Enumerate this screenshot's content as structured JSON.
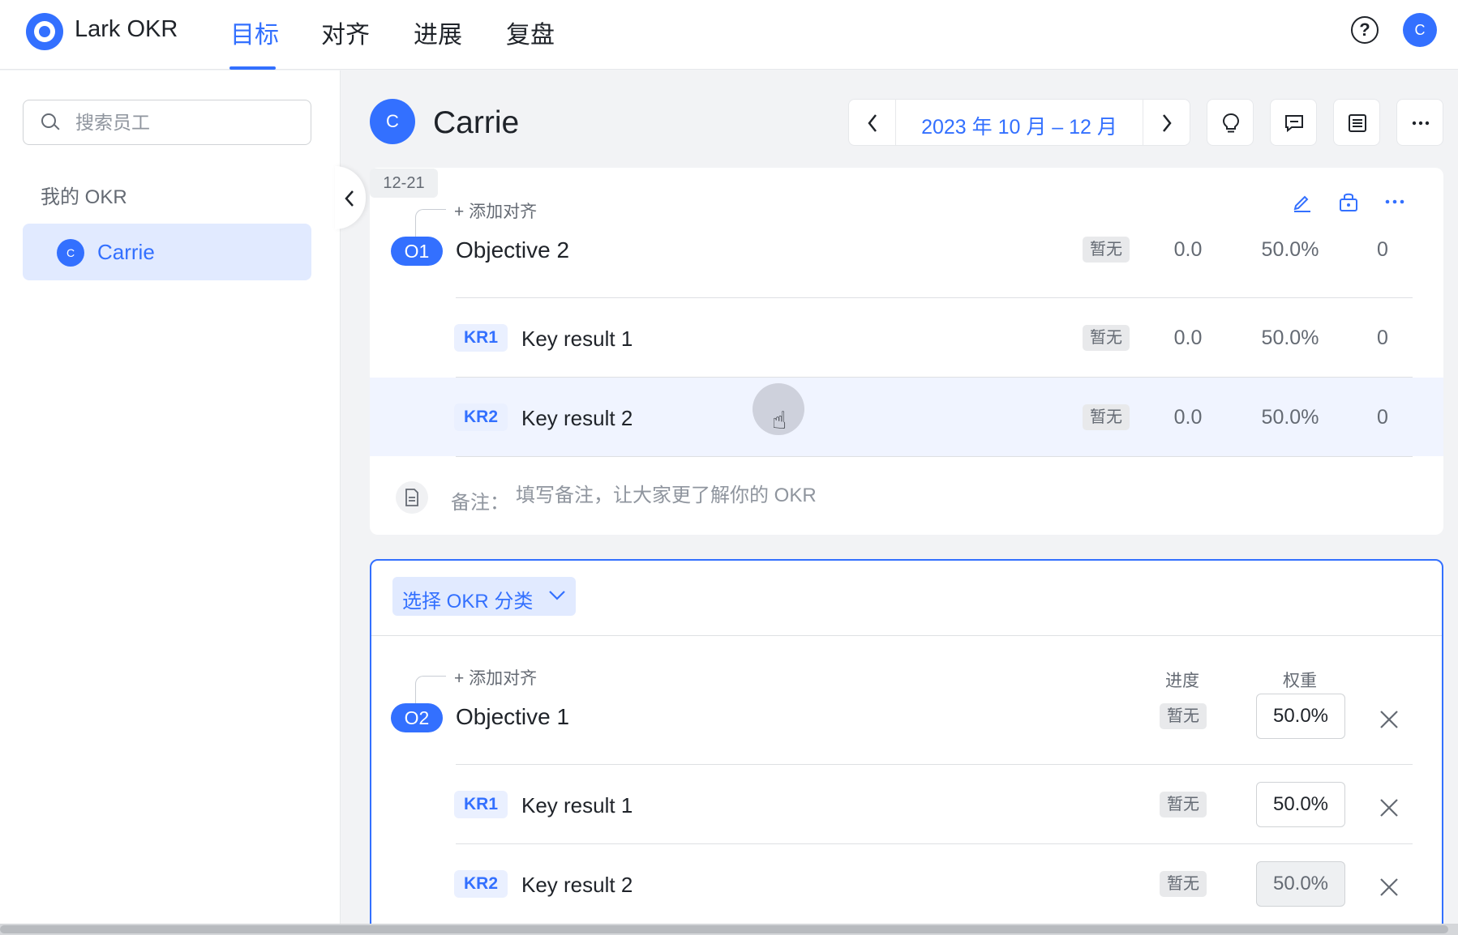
{
  "app": {
    "name": "Lark OKR"
  },
  "nav": {
    "tabs": [
      "目标",
      "对齐",
      "进展",
      "复盘"
    ],
    "active": "目标"
  },
  "sidebar": {
    "search_placeholder": "搜索员工",
    "my_okr_label": "我的 OKR",
    "items": [
      {
        "avatar": "C",
        "name": "Carrie",
        "selected": true
      }
    ]
  },
  "header": {
    "avatar": "C",
    "name": "Carrie",
    "period": "2023 年 10 月 – 12 月",
    "top_avatar": "C",
    "help_symbol": "?"
  },
  "card1": {
    "date_tag": "12-21",
    "add_align": "添加对齐",
    "objective": {
      "badge": "O1",
      "title": "Objective 2",
      "tag": "暂无",
      "score": "0.0",
      "weight": "50.0%",
      "count": "0"
    },
    "key_results": [
      {
        "badge": "KR1",
        "title": "Key result 1",
        "tag": "暂无",
        "score": "0.0",
        "weight": "50.0%",
        "count": "0"
      },
      {
        "badge": "KR2",
        "title": "Key result 2",
        "tag": "暂无",
        "score": "0.0",
        "weight": "50.0%",
        "count": "0"
      }
    ],
    "note_label": "备注：",
    "note_placeholder": "填写备注，让大家更了解你的 OKR"
  },
  "card2": {
    "category_label": "选择 OKR 分类",
    "add_align": "添加对齐",
    "col_progress": "进度",
    "col_weight": "权重",
    "objective": {
      "badge": "O2",
      "title": "Objective 1",
      "tag": "暂无",
      "weight": "50.0%"
    },
    "key_results": [
      {
        "badge": "KR1",
        "title": "Key result 1",
        "tag": "暂无",
        "weight": "50.0%"
      },
      {
        "badge": "KR2",
        "title": "Key result 2",
        "tag": "暂无",
        "weight": "50.0%"
      }
    ]
  },
  "colors": {
    "accent": "#3370ff",
    "accent_light": "#e1eaff",
    "text": "#1f2329",
    "muted": "#646a73"
  },
  "icons": [
    "logo-icon",
    "help-icon",
    "search-icon",
    "chevron-left-icon",
    "chevron-right-icon",
    "lightbulb-icon",
    "comment-icon",
    "list-icon",
    "more-icon",
    "edit-icon",
    "lock-icon",
    "note-icon",
    "chevron-down-icon",
    "close-icon",
    "hand-cursor-icon"
  ]
}
